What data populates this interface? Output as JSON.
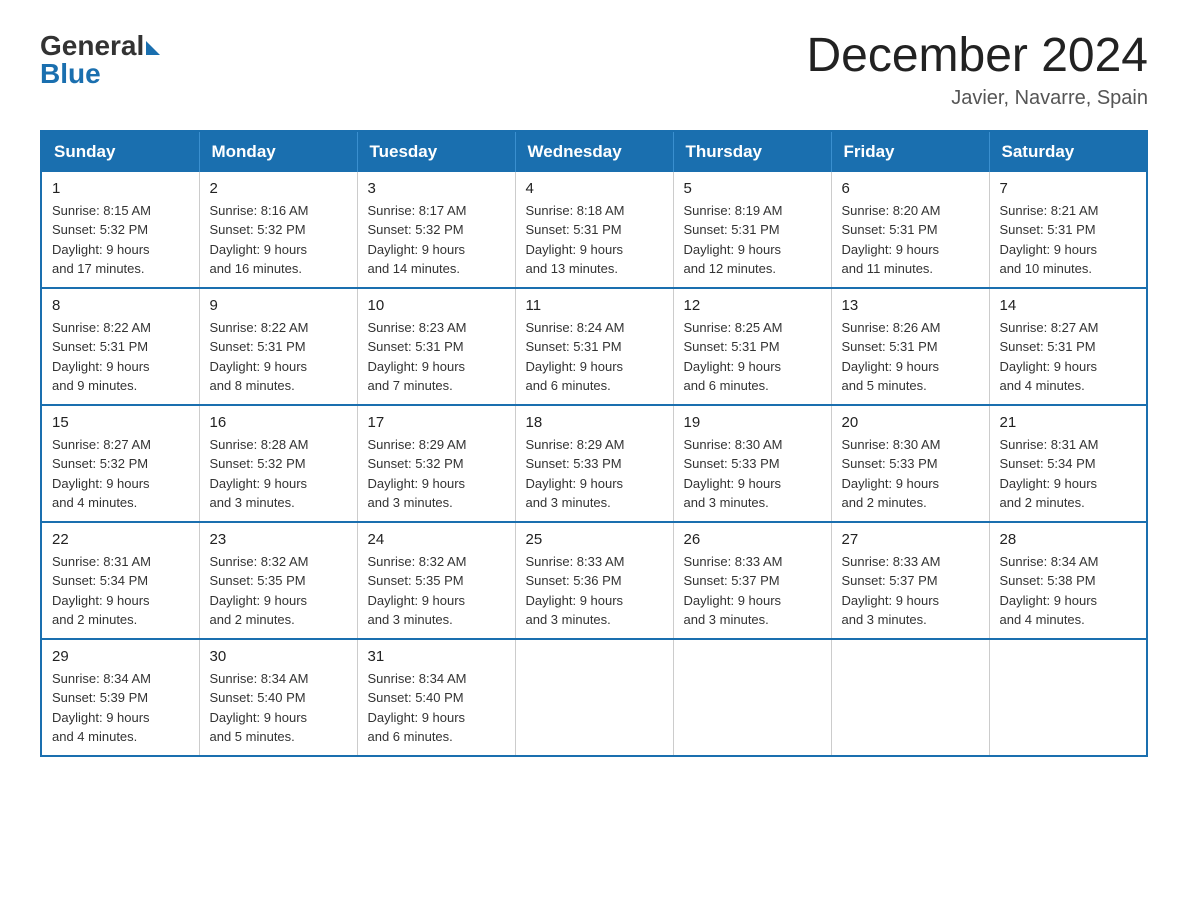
{
  "header": {
    "logo_general": "General",
    "logo_blue": "Blue",
    "month_year": "December 2024",
    "location": "Javier, Navarre, Spain"
  },
  "columns": [
    "Sunday",
    "Monday",
    "Tuesday",
    "Wednesday",
    "Thursday",
    "Friday",
    "Saturday"
  ],
  "weeks": [
    [
      {
        "day": "1",
        "sunrise": "8:15 AM",
        "sunset": "5:32 PM",
        "daylight": "9 hours and 17 minutes."
      },
      {
        "day": "2",
        "sunrise": "8:16 AM",
        "sunset": "5:32 PM",
        "daylight": "9 hours and 16 minutes."
      },
      {
        "day": "3",
        "sunrise": "8:17 AM",
        "sunset": "5:32 PM",
        "daylight": "9 hours and 14 minutes."
      },
      {
        "day": "4",
        "sunrise": "8:18 AM",
        "sunset": "5:31 PM",
        "daylight": "9 hours and 13 minutes."
      },
      {
        "day": "5",
        "sunrise": "8:19 AM",
        "sunset": "5:31 PM",
        "daylight": "9 hours and 12 minutes."
      },
      {
        "day": "6",
        "sunrise": "8:20 AM",
        "sunset": "5:31 PM",
        "daylight": "9 hours and 11 minutes."
      },
      {
        "day": "7",
        "sunrise": "8:21 AM",
        "sunset": "5:31 PM",
        "daylight": "9 hours and 10 minutes."
      }
    ],
    [
      {
        "day": "8",
        "sunrise": "8:22 AM",
        "sunset": "5:31 PM",
        "daylight": "9 hours and 9 minutes."
      },
      {
        "day": "9",
        "sunrise": "8:22 AM",
        "sunset": "5:31 PM",
        "daylight": "9 hours and 8 minutes."
      },
      {
        "day": "10",
        "sunrise": "8:23 AM",
        "sunset": "5:31 PM",
        "daylight": "9 hours and 7 minutes."
      },
      {
        "day": "11",
        "sunrise": "8:24 AM",
        "sunset": "5:31 PM",
        "daylight": "9 hours and 6 minutes."
      },
      {
        "day": "12",
        "sunrise": "8:25 AM",
        "sunset": "5:31 PM",
        "daylight": "9 hours and 6 minutes."
      },
      {
        "day": "13",
        "sunrise": "8:26 AM",
        "sunset": "5:31 PM",
        "daylight": "9 hours and 5 minutes."
      },
      {
        "day": "14",
        "sunrise": "8:27 AM",
        "sunset": "5:31 PM",
        "daylight": "9 hours and 4 minutes."
      }
    ],
    [
      {
        "day": "15",
        "sunrise": "8:27 AM",
        "sunset": "5:32 PM",
        "daylight": "9 hours and 4 minutes."
      },
      {
        "day": "16",
        "sunrise": "8:28 AM",
        "sunset": "5:32 PM",
        "daylight": "9 hours and 3 minutes."
      },
      {
        "day": "17",
        "sunrise": "8:29 AM",
        "sunset": "5:32 PM",
        "daylight": "9 hours and 3 minutes."
      },
      {
        "day": "18",
        "sunrise": "8:29 AM",
        "sunset": "5:33 PM",
        "daylight": "9 hours and 3 minutes."
      },
      {
        "day": "19",
        "sunrise": "8:30 AM",
        "sunset": "5:33 PM",
        "daylight": "9 hours and 3 minutes."
      },
      {
        "day": "20",
        "sunrise": "8:30 AM",
        "sunset": "5:33 PM",
        "daylight": "9 hours and 2 minutes."
      },
      {
        "day": "21",
        "sunrise": "8:31 AM",
        "sunset": "5:34 PM",
        "daylight": "9 hours and 2 minutes."
      }
    ],
    [
      {
        "day": "22",
        "sunrise": "8:31 AM",
        "sunset": "5:34 PM",
        "daylight": "9 hours and 2 minutes."
      },
      {
        "day": "23",
        "sunrise": "8:32 AM",
        "sunset": "5:35 PM",
        "daylight": "9 hours and 2 minutes."
      },
      {
        "day": "24",
        "sunrise": "8:32 AM",
        "sunset": "5:35 PM",
        "daylight": "9 hours and 3 minutes."
      },
      {
        "day": "25",
        "sunrise": "8:33 AM",
        "sunset": "5:36 PM",
        "daylight": "9 hours and 3 minutes."
      },
      {
        "day": "26",
        "sunrise": "8:33 AM",
        "sunset": "5:37 PM",
        "daylight": "9 hours and 3 minutes."
      },
      {
        "day": "27",
        "sunrise": "8:33 AM",
        "sunset": "5:37 PM",
        "daylight": "9 hours and 3 minutes."
      },
      {
        "day": "28",
        "sunrise": "8:34 AM",
        "sunset": "5:38 PM",
        "daylight": "9 hours and 4 minutes."
      }
    ],
    [
      {
        "day": "29",
        "sunrise": "8:34 AM",
        "sunset": "5:39 PM",
        "daylight": "9 hours and 4 minutes."
      },
      {
        "day": "30",
        "sunrise": "8:34 AM",
        "sunset": "5:40 PM",
        "daylight": "9 hours and 5 minutes."
      },
      {
        "day": "31",
        "sunrise": "8:34 AM",
        "sunset": "5:40 PM",
        "daylight": "9 hours and 6 minutes."
      },
      null,
      null,
      null,
      null
    ]
  ],
  "labels": {
    "sunrise": "Sunrise:",
    "sunset": "Sunset:",
    "daylight": "Daylight:"
  }
}
